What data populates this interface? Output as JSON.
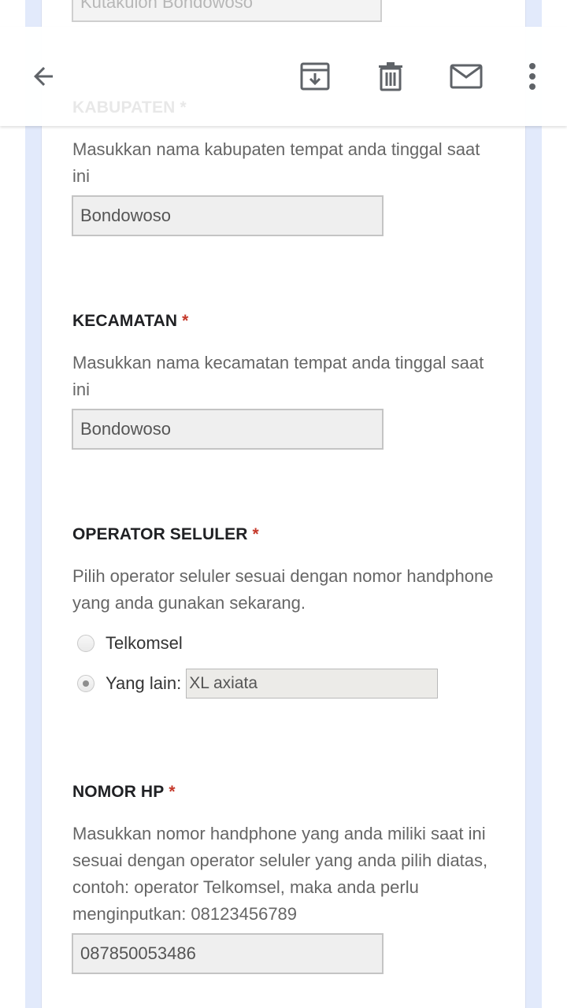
{
  "previous_field": {
    "value": "Kutakulon Bondowoso"
  },
  "toolbar": {
    "back_icon": "arrow-left-icon",
    "archive_icon": "archive-icon",
    "delete_icon": "trash-icon",
    "mail_icon": "mail-icon",
    "more_icon": "more-vert-icon",
    "icon_color": "#5f6368"
  },
  "questions": {
    "kabupaten": {
      "title": "KABUPATEN",
      "required_mark": "*",
      "description": "Masukkan nama kabupaten tempat anda tinggal saat ini",
      "value": "Bondowoso"
    },
    "kecamatan": {
      "title": "KECAMATAN",
      "required_mark": "*",
      "description": "Masukkan nama kecamatan tempat anda tinggal saat ini",
      "value": "Bondowoso"
    },
    "operator": {
      "title": "OPERATOR SELULER",
      "required_mark": "*",
      "description": "Pilih operator seluler sesuai dengan nomor handphone yang anda gunakan sekarang.",
      "options": [
        {
          "label": "Telkomsel",
          "checked": false
        },
        {
          "label": "Yang lain:",
          "checked": true
        }
      ],
      "other_value": "XL axiata"
    },
    "nomor_hp": {
      "title": "NOMOR HP",
      "required_mark": "*",
      "description": "Masukkan nomor handphone yang anda miliki saat ini sesuai dengan operator seluler yang anda pilih diatas, contoh: operator Telkomsel, maka anda perlu menginputkan: 08123456789",
      "value": "087850053486"
    }
  },
  "colors": {
    "required": "#c5392b",
    "side_stripe": "#e2eafb"
  }
}
